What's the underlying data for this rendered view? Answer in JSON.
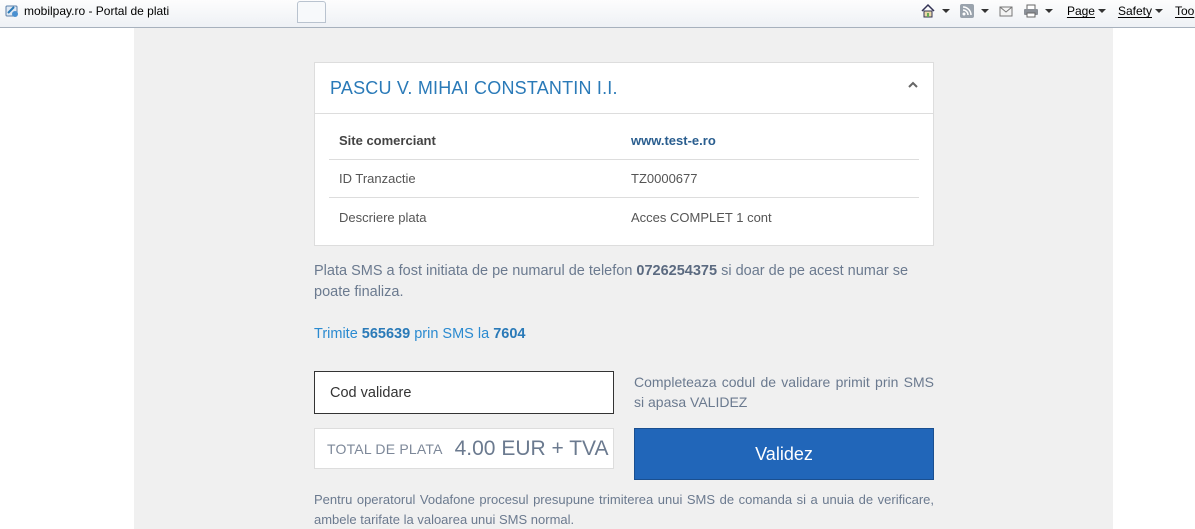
{
  "browser": {
    "tab_title": "mobilpay.ro - Portal de plati",
    "toolbar": {
      "page_label": "Page",
      "safety_label": "Safety",
      "tools_label": "Too"
    }
  },
  "card": {
    "merchant_name": "PASCU V. MIHAI CONSTANTIN I.I.",
    "rows": [
      {
        "label": "Site comerciant",
        "value": "www.test-e.ro"
      },
      {
        "label": "ID Tranzactie",
        "value": "TZ0000677"
      },
      {
        "label": "Descriere plata",
        "value": "Acces COMPLET 1 cont"
      }
    ]
  },
  "info": {
    "prefix": "Plata SMS a fost initiata de pe numarul de telefon ",
    "phone": "0726254375",
    "suffix": " si doar de pe acest numar se poate finaliza."
  },
  "sms": {
    "prefix": "Trimite ",
    "code": "565639",
    "middle": " prin SMS la ",
    "number": "7604"
  },
  "form": {
    "code_placeholder": "Cod validare",
    "hint": "Completeaza codul de validare primit prin SMS si apasa VALIDEZ",
    "total_label": "TOTAL DE PLATA",
    "total_amount": "4.00 EUR + TVA",
    "submit_label": "Validez"
  },
  "note": "Pentru operatorul Vodafone procesul presupune trimiterea unui SMS de comanda si a unuia de verificare, ambele tarifate la valoarea unui SMS normal.",
  "colors": {
    "accent": "#2a7ab8",
    "button": "#2166b9",
    "page_bg": "#f0f0f0"
  }
}
